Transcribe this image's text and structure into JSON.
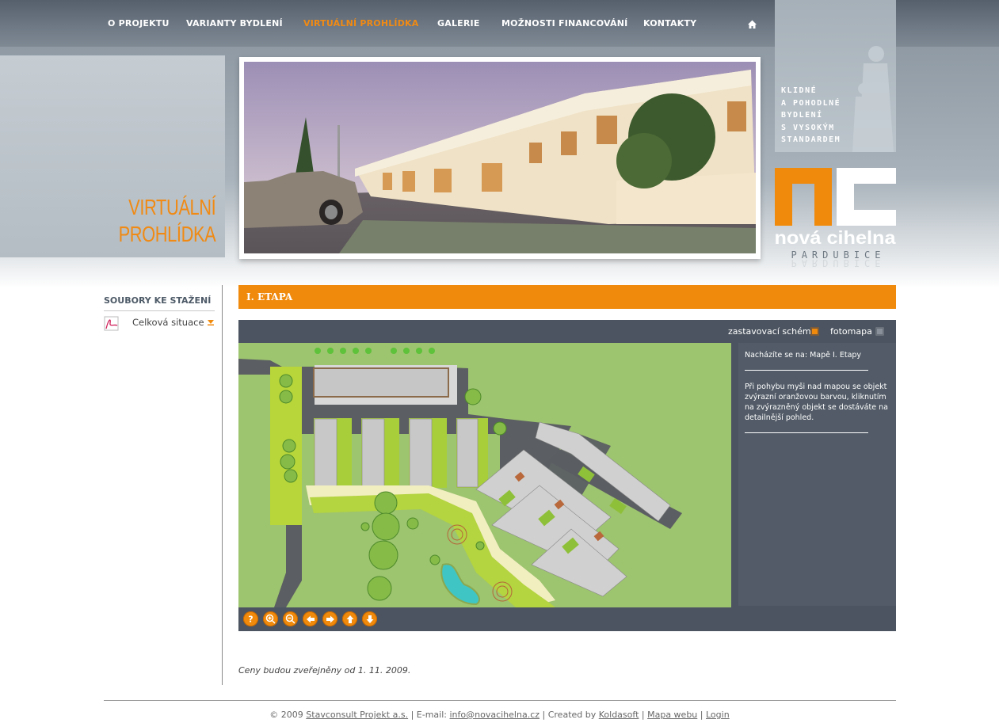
{
  "nav": {
    "items": [
      {
        "label": "O PROJEKTU",
        "active": false
      },
      {
        "label": "VARIANTY BYDLENÍ",
        "active": false
      },
      {
        "label": "VIRTUÁLNÍ PROHLÍDKA",
        "active": true
      },
      {
        "label": "GALERIE",
        "active": false
      },
      {
        "label": "MOŽNOSTI FINANCOVÁNÍ",
        "active": false
      },
      {
        "label": "KONTAKTY",
        "active": false
      }
    ],
    "home_icon": "home-icon"
  },
  "page": {
    "heading_line1": "VIRTUÁLNÍ",
    "heading_line2": "PROHLÍDKA"
  },
  "brand": {
    "tagline": [
      "KLIDNÉ",
      "A POHODLNÉ",
      "BYDLENÍ",
      "S VYSOKÝM",
      "STANDARDEM"
    ],
    "logo_letters": "nc",
    "logo_name": "nová cihelna",
    "logo_city": "PARDUBICE"
  },
  "sidebar": {
    "title": "SOUBORY KE STAŽENÍ",
    "items": [
      {
        "label": "Celková situace",
        "icon": "pdf-icon"
      }
    ]
  },
  "section": {
    "title": "I. ETAPA"
  },
  "viewer": {
    "options": [
      {
        "label": "zastavovací schéma",
        "active": true
      },
      {
        "label": "fotomapa",
        "active": false
      }
    ],
    "info": {
      "location": "Nacházíte se na: Mapě I. Etapy",
      "help": "Při pohybu myši nad mapou se objekt zvýrazní oranžovou barvou, kliknutím na zvýrazněný objekt se dostáváte na detailnější pohled."
    },
    "tools": [
      "help-icon",
      "zoom-in-icon",
      "zoom-out-icon",
      "arrow-left-icon",
      "arrow-right-icon",
      "arrow-up-icon",
      "arrow-down-icon"
    ]
  },
  "prices_note": "Ceny budou zveřejněny od 1. 11. 2009.",
  "footer": {
    "copyright": "© 2009",
    "company": "Stavconsult Projekt a.s.",
    "email_label": "| E-mail:",
    "email": "info@novacihelna.cz",
    "created_label": "| Created by",
    "creator": "Koldasoft",
    "sep": "|",
    "sitemap": "Mapa webu",
    "login": "Login"
  },
  "colors": {
    "accent": "#f08a0c",
    "nav_bg": "#5e6874",
    "viewer_bg": "#4b5460",
    "map_green": "#9dc46f"
  }
}
